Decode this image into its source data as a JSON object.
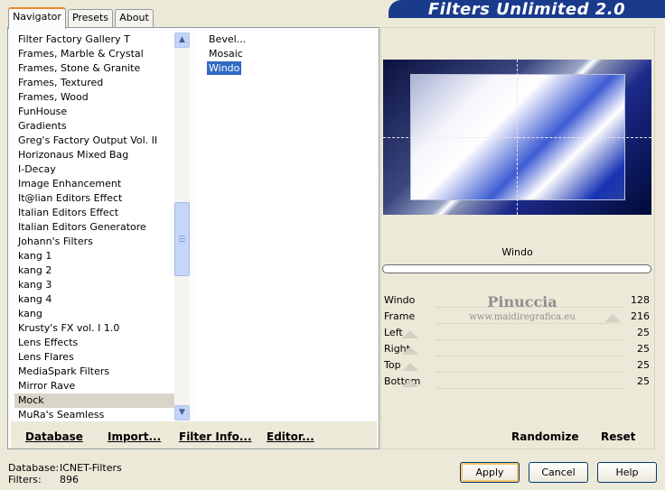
{
  "banner_title": "Filters Unlimited 2.0",
  "tabs": [
    {
      "label": "Navigator"
    },
    {
      "label": "Presets"
    },
    {
      "label": "About"
    }
  ],
  "categories": [
    "Filter Factory Gallery T",
    "Frames, Marble & Crystal",
    "Frames, Stone & Granite",
    "Frames, Textured",
    "Frames, Wood",
    "FunHouse",
    "Gradients",
    "Greg's Factory Output Vol. II",
    "Horizonaus Mixed Bag",
    "I-Decay",
    "Image Enhancement",
    "It@lian Editors Effect",
    "Italian Editors Effect",
    "Italian Editors Generatore",
    "Johann's Filters",
    "kang 1",
    "kang 2",
    "kang 3",
    "kang 4",
    "kang",
    "Krusty's FX vol. I 1.0",
    "Lens Effects",
    "Lens Flares",
    "MediaSpark Filters",
    "Mirror Rave",
    "Mock",
    "MuRa's Seamless"
  ],
  "selected_category": "Mock",
  "filters": [
    "Bevel...",
    "Mosaic",
    "Windo"
  ],
  "selected_filter": "Windo",
  "bottom_links": {
    "database": "Database",
    "import": "Import...",
    "filter_info": "Filter Info...",
    "editor": "Editor..."
  },
  "filter_name": "Windo",
  "params": [
    {
      "label": "Windo",
      "value": "128"
    },
    {
      "label": "Frame",
      "value": "216"
    },
    {
      "label": "Left",
      "value": "25"
    },
    {
      "label": "Right",
      "value": "25"
    },
    {
      "label": "Top",
      "value": "25"
    },
    {
      "label": "Bottom",
      "value": "25"
    }
  ],
  "watermark": {
    "name": "Pinuccia",
    "url": "www.maidiregrafica.eu"
  },
  "randomize_label": "Randomize",
  "reset_label": "Reset",
  "footer": {
    "database_label": "Database:",
    "database_value": "ICNET-Filters",
    "filters_label": "Filters:",
    "filters_value": "896"
  },
  "buttons": {
    "apply": "Apply",
    "cancel": "Cancel",
    "help": "Help"
  }
}
